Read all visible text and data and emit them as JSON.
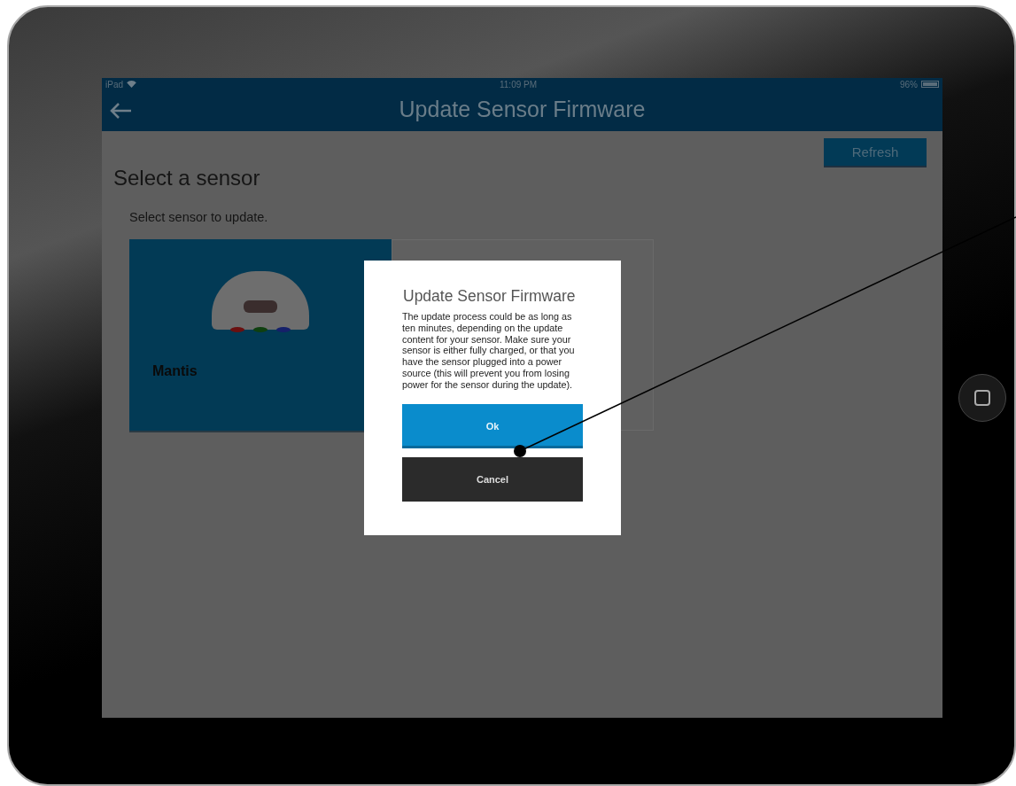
{
  "status_bar": {
    "carrier": "iPad",
    "time": "11:09 PM",
    "battery": "96%"
  },
  "nav_bar": {
    "title": "Update Sensor Firmware"
  },
  "toolbar": {
    "refresh": "Refresh"
  },
  "page": {
    "heading": "Select a sensor",
    "instruction": "Select sensor to update."
  },
  "sensors": [
    {
      "name": "Mantis",
      "selected": true
    },
    {
      "selected": false
    }
  ],
  "dialog": {
    "title": "Update Sensor Firmware",
    "message": "The update process could be as long as ten minutes, depending on the update content for your sensor. Make sure your sensor is either fully charged, or that you have the sensor plugged into a power source (this will prevent you from losing power for the sensor during the update).",
    "buttons": [
      {
        "label": "Ok",
        "kind": "primary"
      },
      {
        "label": "Cancel",
        "kind": "secondary"
      }
    ]
  }
}
